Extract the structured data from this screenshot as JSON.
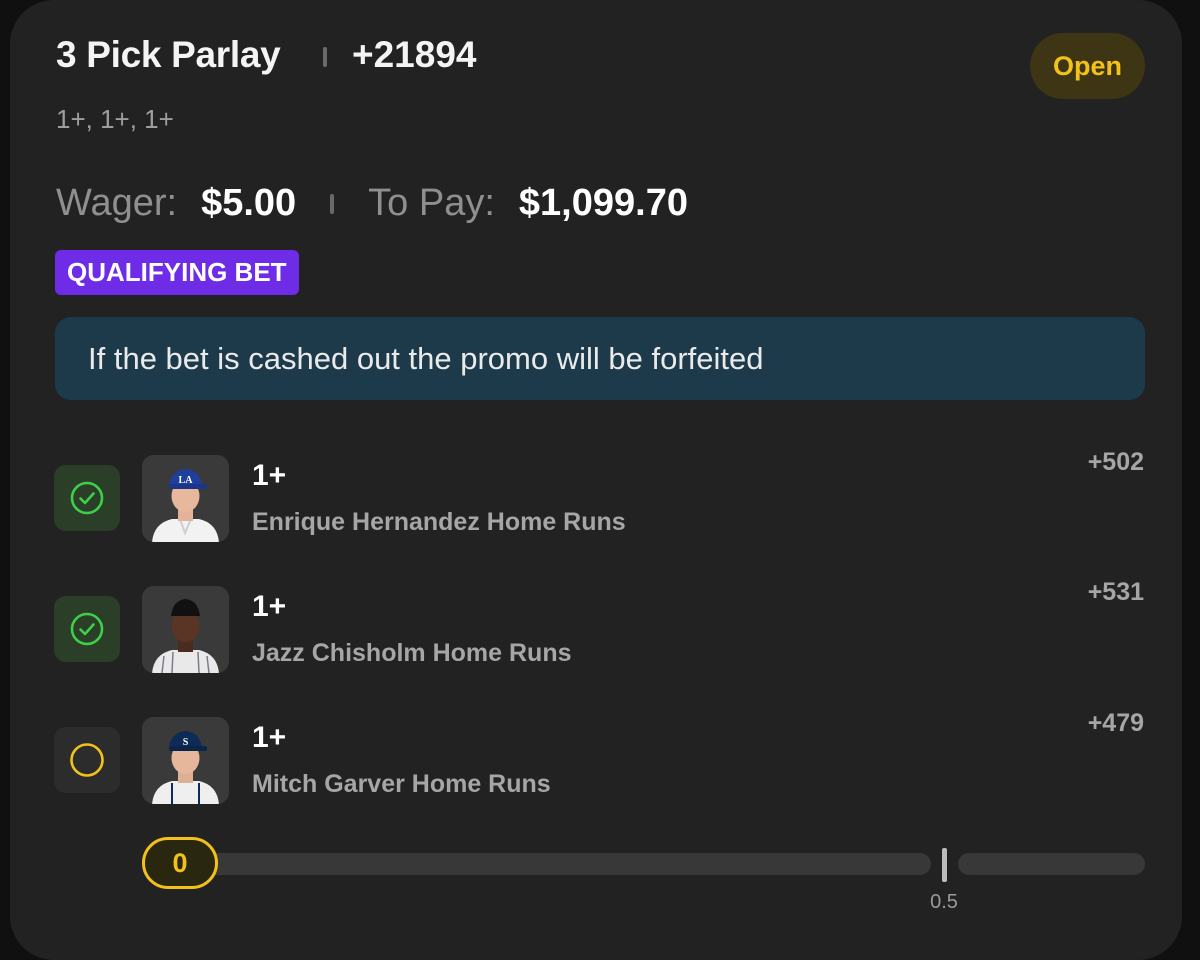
{
  "bet": {
    "title": "3 Pick Parlay",
    "odds": "+21894",
    "status": "Open",
    "legs_summary": "1+, 1+, 1+",
    "wager_label": "Wager:",
    "wager_value": "$5.00",
    "to_pay_label": "To Pay:",
    "to_pay_value": "$1,099.70",
    "badge": "QUALIFYING BET",
    "promo_notice": "If the bet is cashed out the promo will be forfeited"
  },
  "legs": [
    {
      "line": "1+",
      "market": "Enrique Hernandez Home Runs",
      "odds": "+502",
      "status": "won",
      "status_icon": "check-circle-icon",
      "player_cap": "dodgers-cap"
    },
    {
      "line": "1+",
      "market": "Jazz Chisholm Home Runs",
      "odds": "+531",
      "status": "won",
      "status_icon": "check-circle-icon",
      "player_cap": "none"
    },
    {
      "line": "1+",
      "market": "Mitch Garver Home Runs",
      "odds": "+479",
      "status": "open",
      "status_icon": "empty-circle-icon",
      "player_cap": "mariners-cap"
    }
  ],
  "progress": {
    "current": "0",
    "threshold_label": "0.5",
    "fill_fraction": 0
  },
  "colors": {
    "accent_yellow": "#f2c21b",
    "won_green": "#3ecf4a",
    "badge_purple": "#6e2ce6",
    "notice_blue": "#1d3a4b"
  }
}
